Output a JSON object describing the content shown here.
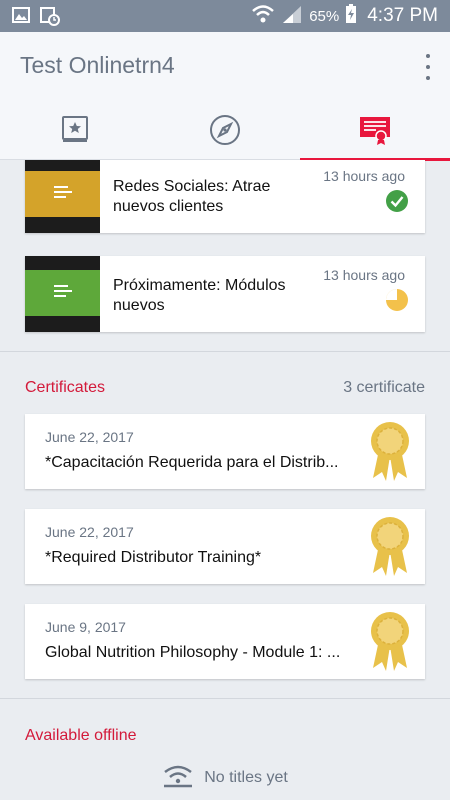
{
  "status_bar": {
    "battery": "65%",
    "time": "4:37 PM"
  },
  "app_bar": {
    "title": "Test Onlinetrn4"
  },
  "tabs": [
    {
      "name": "library",
      "icon": "book-star-icon"
    },
    {
      "name": "explore",
      "icon": "compass-icon"
    },
    {
      "name": "certificates",
      "icon": "certificate-icon",
      "active": true
    }
  ],
  "courses": [
    {
      "title": "Redes Sociales: Atrae nuevos clientes",
      "time": "13 hours ago",
      "thumb_color": "#d4a32a",
      "status": "completed"
    },
    {
      "title": "Próximamente: Módulos nuevos",
      "time": "13 hours ago",
      "thumb_color": "#5ea83a",
      "status": "in-progress"
    }
  ],
  "certificates": {
    "title": "Certificates",
    "count": "3 certificate",
    "items": [
      {
        "date": "June 22, 2017",
        "name": "*Capacitación Requerida para el Distrib..."
      },
      {
        "date": "June 22, 2017",
        "name": "*Required Distributor Training*"
      },
      {
        "date": "June 9, 2017",
        "name": "Global Nutrition Philosophy - Module 1: ..."
      }
    ]
  },
  "offline": {
    "title": "Available offline",
    "empty": "No titles yet"
  },
  "colors": {
    "accent": "#e8173d",
    "status_bar": "#7d8a9b",
    "muted": "#6a7584",
    "gold": "#e8c14a",
    "green": "#43a047"
  }
}
